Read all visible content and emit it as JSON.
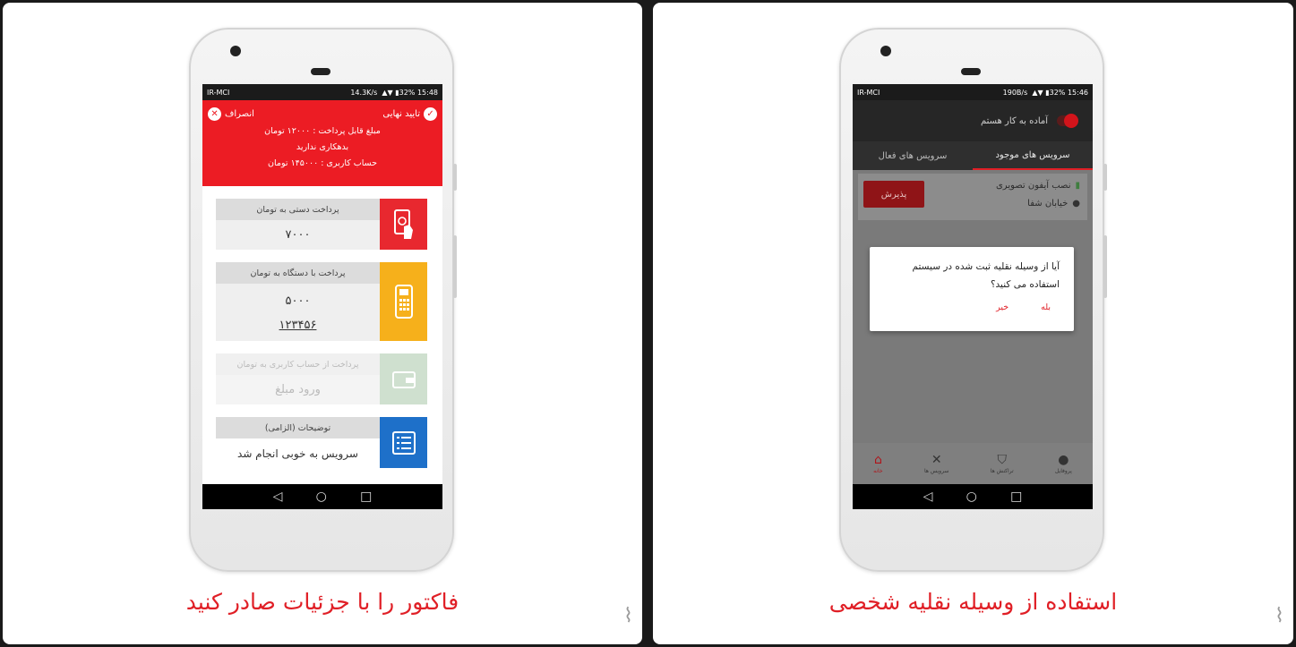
{
  "left": {
    "caption": "فاکتور را با جزئیات صادر کنید",
    "status": {
      "carrier": "IR-MCI",
      "speed": "14.3K/s",
      "battery": "32%",
      "time": "15:48"
    },
    "header": {
      "confirm": "تایید نهایی",
      "cancel": "انصراف",
      "amount_due": "مبلغ قابل پرداخت : ۱۲۰۰۰ تومان",
      "debt": "بدهکاری ندارید",
      "balance": "حساب کاربری : ۱۴۵۰۰۰ تومان"
    },
    "rows": [
      {
        "label": "پرداخت دستی به تومان",
        "value": "۷۰۰۰",
        "icon": "hand-phone-icon",
        "color": "#e8282f"
      },
      {
        "label": "پرداخت با دستگاه به تومان",
        "value": "۵۰۰۰",
        "code": "۱۲۳۴۵۶",
        "icon": "pos-device-icon",
        "color": "#f6b01b"
      },
      {
        "label": "پرداخت از حساب کاربری به تومان",
        "value": "ورود مبلغ",
        "icon": "wallet-icon",
        "color": "#cfe0cf"
      },
      {
        "label": "توضیحات (الزامی)",
        "value": "سرویس به خوبی انجام شد",
        "icon": "list-icon",
        "color": "#1e70c9"
      }
    ]
  },
  "right": {
    "caption": "استفاده از وسیله نقلیه شخصی",
    "status": {
      "carrier": "IR-MCI",
      "speed": "190B/s",
      "battery": "32%",
      "time": "15:46"
    },
    "ready_label": "آماده به کار هستم",
    "tabs": [
      "سرویس های موجود",
      "سرویس های فعال"
    ],
    "service": {
      "title": "نصب آیفون تصویری",
      "address": "خیابان شفا",
      "accept": "پذیرش"
    },
    "dialog": {
      "line1": "آیا از وسیله نقلیه ثبت شده در سیستم",
      "line2": "استفاده می کنید؟",
      "yes": "بله",
      "no": "خیر"
    },
    "bottom_nav": [
      "پروفایل",
      "تراکنش ها",
      "سرویس ها",
      "خانه"
    ]
  }
}
